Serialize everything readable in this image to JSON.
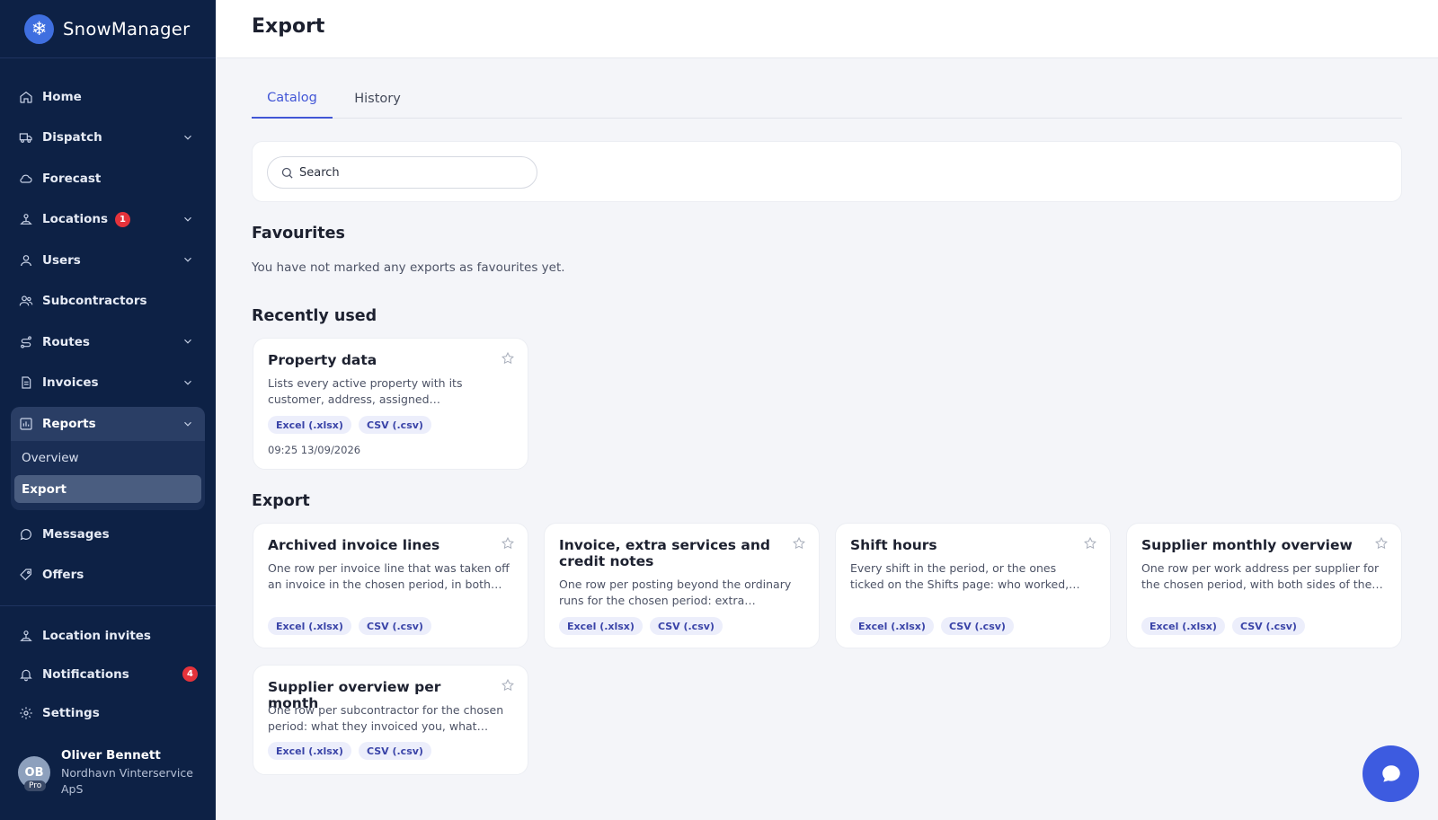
{
  "brand": {
    "name": "SnowManager"
  },
  "sidebar": {
    "items": [
      {
        "label": "Home",
        "icon": "home-icon"
      },
      {
        "label": "Dispatch",
        "icon": "truck-icon",
        "expandable": true
      },
      {
        "label": "Forecast",
        "icon": "cloud-icon"
      },
      {
        "label": "Locations",
        "icon": "location-icon",
        "expandable": true,
        "badge": "1"
      },
      {
        "label": "Users",
        "icon": "user-icon",
        "expandable": true
      },
      {
        "label": "Subcontractors",
        "icon": "users-icon"
      },
      {
        "label": "Routes",
        "icon": "route-icon",
        "expandable": true
      },
      {
        "label": "Invoices",
        "icon": "invoice-icon",
        "expandable": true
      }
    ],
    "reports": {
      "label": "Reports",
      "icon": "bar-chart-icon",
      "sub_items": [
        {
          "label": "Overview",
          "active": false
        },
        {
          "label": "Export",
          "active": true
        }
      ]
    },
    "after_reports": [
      {
        "label": "Messages",
        "icon": "message-icon"
      },
      {
        "label": "Offers",
        "icon": "offers-icon"
      }
    ],
    "bottom": [
      {
        "label": "Location invites",
        "icon": "location-invite-icon"
      },
      {
        "label": "Notifications",
        "icon": "bell-icon",
        "badge": "4"
      },
      {
        "label": "Settings",
        "icon": "gear-icon"
      }
    ],
    "user": {
      "initials": "OB",
      "plan": "Pro",
      "name": "Oliver Bennett",
      "company": "Nordhavn Vinterservice ApS"
    }
  },
  "header": {
    "title": "Export"
  },
  "tabs": [
    {
      "label": "Catalog",
      "active": true
    },
    {
      "label": "History",
      "active": false
    }
  ],
  "search": {
    "placeholder": "Search",
    "value": ""
  },
  "favourites": {
    "title": "Favourites",
    "empty_text": "You have not marked any exports as favourites yet."
  },
  "recently_used": {
    "title": "Recently used",
    "cards": [
      {
        "title": "Property data",
        "description": "Lists every active property with its customer, address, assigned…",
        "formats": [
          "Excel (.xlsx)",
          "CSV (.csv)"
        ],
        "timestamp": "09:25 13/09/2026"
      }
    ]
  },
  "export": {
    "title": "Export",
    "cards": [
      {
        "title": "Archived invoice lines",
        "description": "One row per invoice line that was taken off an invoice in the chosen period, in both…",
        "formats": [
          "Excel (.xlsx)",
          "CSV (.csv)"
        ]
      },
      {
        "title": "Invoice, extra services and credit notes",
        "description": "One row per posting beyond the ordinary runs for the chosen period: extra services,…",
        "formats": [
          "Excel (.xlsx)",
          "CSV (.csv)"
        ]
      },
      {
        "title": "Shift hours",
        "description": "Every shift in the period, or the ones ticked on the Shifts page: who worked, when th…",
        "formats": [
          "Excel (.xlsx)",
          "CSV (.csv)"
        ]
      },
      {
        "title": "Supplier monthly overview",
        "description": "One row per work address per supplier for the chosen period, with both sides of the…",
        "formats": [
          "Excel (.xlsx)",
          "CSV (.csv)"
        ]
      },
      {
        "title": "Supplier overview per month",
        "description": "One row per subcontractor for the chosen period: what they invoiced you, what their…",
        "formats": [
          "Excel (.xlsx)",
          "CSV (.csv)"
        ]
      }
    ]
  },
  "colors": {
    "sidebar_bg": "#0d2145",
    "accent": "#4256d6",
    "badge_red": "#e5333b",
    "chip_bg": "#eceefb",
    "fab": "#3d5be0"
  },
  "fab": {
    "icon": "chat-bubble-icon"
  }
}
